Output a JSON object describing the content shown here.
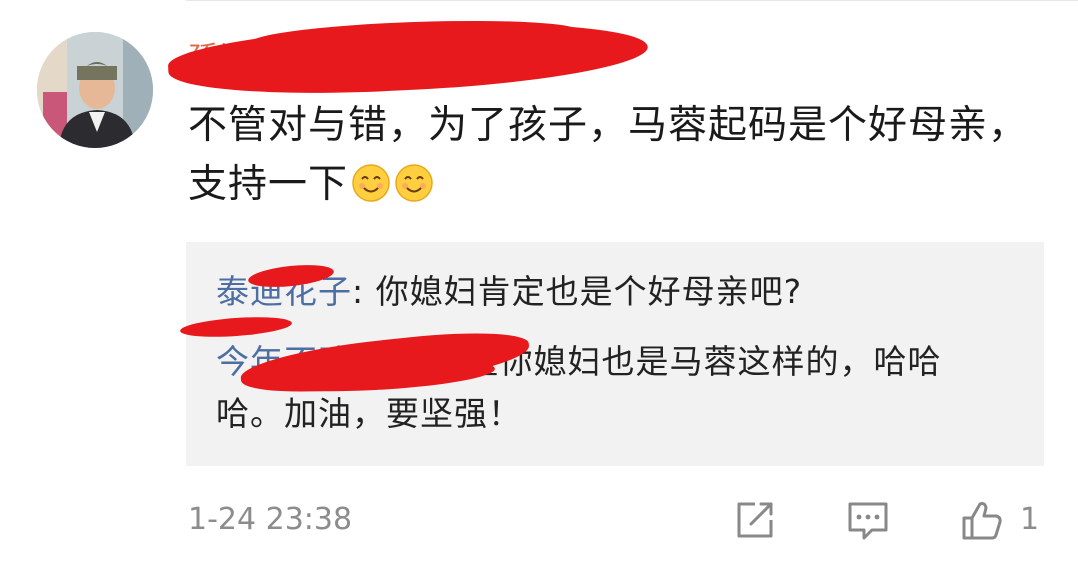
{
  "comment": {
    "username": "孫澀 ",
    "text": "不管对与错，为了孩子，马蓉起码是个好母亲，支持一下",
    "emojis": [
      "smile-emoji-icon",
      "smile-emoji-icon"
    ],
    "timestamp": "1-24 23:38",
    "like_count": "1"
  },
  "replies": [
    {
      "user": "泰迪花子",
      "separator": ": ",
      "text": "你媳妇肯定也是个好母亲吧?"
    },
    {
      "user": "今年不改昵称",
      "separator": "  ",
      "text": "希望你媳妇也是马蓉这样的，哈哈哈。加油，要坚强！"
    }
  ],
  "actions": {
    "icons": [
      "share-icon",
      "reply-icon",
      "like-icon"
    ]
  },
  "colors": {
    "username": "#dd6a4a",
    "reply_user": "#4d6ea3",
    "reply_bg": "#f2f2f2",
    "meta_text": "#8c8c8c",
    "redaction": "#e8191c",
    "vip": "#f5b72d"
  }
}
